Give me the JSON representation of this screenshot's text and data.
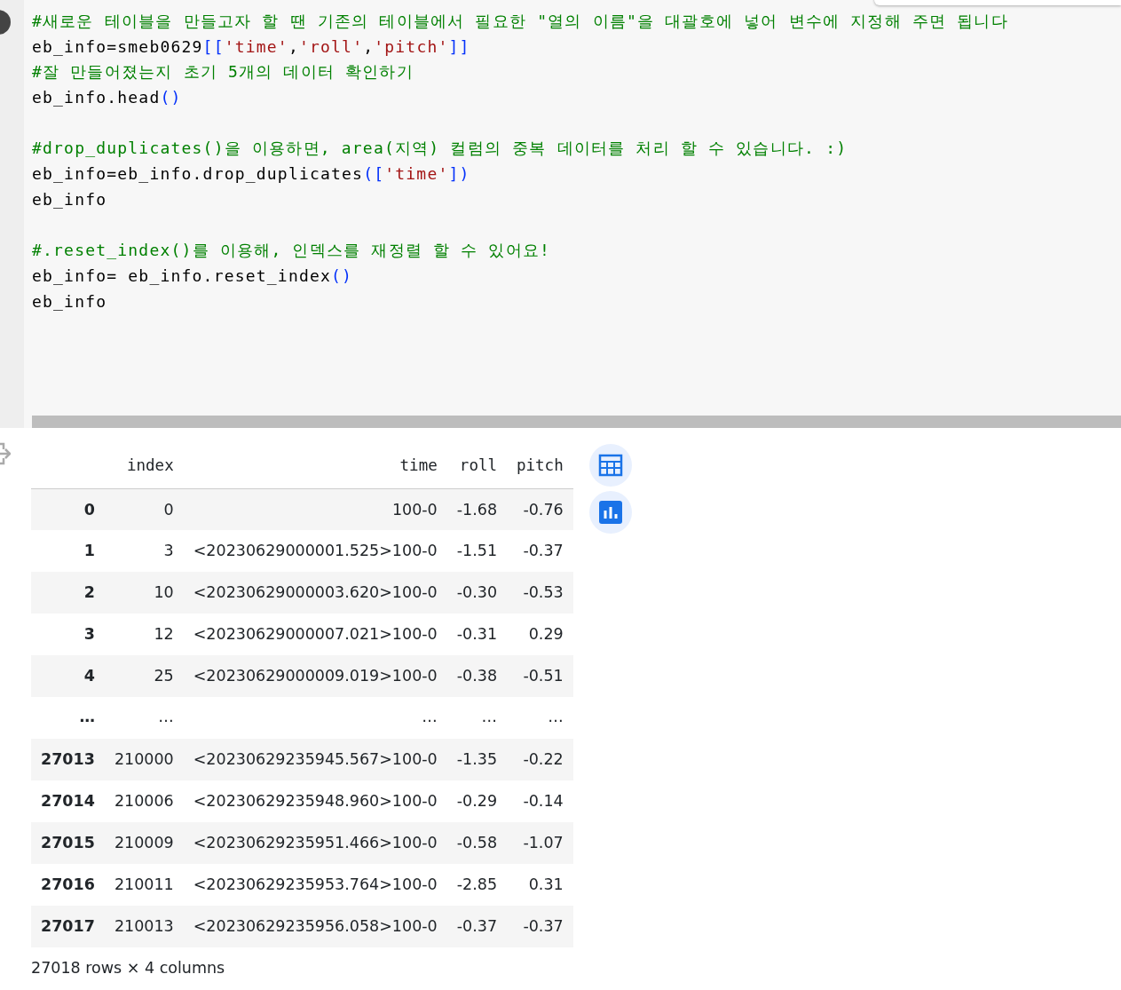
{
  "code_cell": {
    "lines": [
      {
        "kind": "code",
        "tokens": [
          {
            "kind": "comment",
            "text": "#새로운 테이블을 만들고자 할 땐 기존의 테이블에서 필요한 \"열의 이름\"을 대괄호에 넣어 변수에 지정해 주면 됩니다"
          }
        ]
      },
      {
        "kind": "code",
        "tokens": [
          {
            "kind": "plain",
            "text": "eb_info=smeb0629"
          },
          {
            "kind": "bracket",
            "text": "[["
          },
          {
            "kind": "string",
            "text": "'time'"
          },
          {
            "kind": "plain",
            "text": ","
          },
          {
            "kind": "string",
            "text": "'roll'"
          },
          {
            "kind": "plain",
            "text": ","
          },
          {
            "kind": "string",
            "text": "'pitch'"
          },
          {
            "kind": "bracket",
            "text": "]]"
          }
        ]
      },
      {
        "kind": "code",
        "tokens": [
          {
            "kind": "comment",
            "text": "#잘 만들어졌는지 초기 5개의 데이터 확인하기"
          }
        ]
      },
      {
        "kind": "code",
        "tokens": [
          {
            "kind": "plain",
            "text": "eb_info.head"
          },
          {
            "kind": "bracket",
            "text": "()"
          }
        ]
      },
      {
        "kind": "blank"
      },
      {
        "kind": "code",
        "tokens": [
          {
            "kind": "comment",
            "text": "#drop_duplicates()을 이용하면, area(지역) 컬럼의 중복 데이터를 처리 할 수 있습니다. :)"
          }
        ]
      },
      {
        "kind": "code",
        "tokens": [
          {
            "kind": "plain",
            "text": "eb_info=eb_info.drop_duplicates"
          },
          {
            "kind": "bracket",
            "text": "(["
          },
          {
            "kind": "string",
            "text": "'time'"
          },
          {
            "kind": "bracket",
            "text": "])"
          }
        ]
      },
      {
        "kind": "code",
        "tokens": [
          {
            "kind": "plain",
            "text": "eb_info"
          }
        ]
      },
      {
        "kind": "blank"
      },
      {
        "kind": "code",
        "tokens": [
          {
            "kind": "comment",
            "text": "#.reset_index()를 이용해, 인덱스를 재정렬 할 수 있어요!"
          }
        ]
      },
      {
        "kind": "code",
        "tokens": [
          {
            "kind": "plain",
            "text": "eb_info= eb_info.reset_index"
          },
          {
            "kind": "bracket",
            "text": "()"
          }
        ]
      },
      {
        "kind": "code",
        "tokens": [
          {
            "kind": "plain",
            "text": "eb_info"
          }
        ]
      }
    ]
  },
  "output": {
    "table": {
      "columns": [
        "",
        "index",
        "time",
        "roll",
        "pitch"
      ],
      "rows": [
        {
          "kind": "data",
          "cells": [
            "0",
            "0",
            "100-0",
            "-1.68",
            "-0.76"
          ]
        },
        {
          "kind": "data",
          "cells": [
            "1",
            "3",
            "<20230629000001.525>100-0",
            "-1.51",
            "-0.37"
          ]
        },
        {
          "kind": "data",
          "cells": [
            "2",
            "10",
            "<20230629000003.620>100-0",
            "-0.30",
            "-0.53"
          ]
        },
        {
          "kind": "data",
          "cells": [
            "3",
            "12",
            "<20230629000007.021>100-0",
            "-0.31",
            "0.29"
          ]
        },
        {
          "kind": "data",
          "cells": [
            "4",
            "25",
            "<20230629000009.019>100-0",
            "-0.38",
            "-0.51"
          ]
        },
        {
          "kind": "ellipsis",
          "cells": [
            "…",
            "…",
            "…",
            "…",
            "…"
          ]
        },
        {
          "kind": "data",
          "cells": [
            "27013",
            "210000",
            "<20230629235945.567>100-0",
            "-1.35",
            "-0.22"
          ]
        },
        {
          "kind": "data",
          "cells": [
            "27014",
            "210006",
            "<20230629235948.960>100-0",
            "-0.29",
            "-0.14"
          ]
        },
        {
          "kind": "data",
          "cells": [
            "27015",
            "210009",
            "<20230629235951.466>100-0",
            "-0.58",
            "-1.07"
          ]
        },
        {
          "kind": "data",
          "cells": [
            "27016",
            "210011",
            "<20230629235953.764>100-0",
            "-2.85",
            "0.31"
          ]
        },
        {
          "kind": "data",
          "cells": [
            "27017",
            "210013",
            "<20230629235956.058>100-0",
            "-0.37",
            "-0.37"
          ]
        }
      ]
    },
    "summary": "27018 rows × 4 columns"
  }
}
